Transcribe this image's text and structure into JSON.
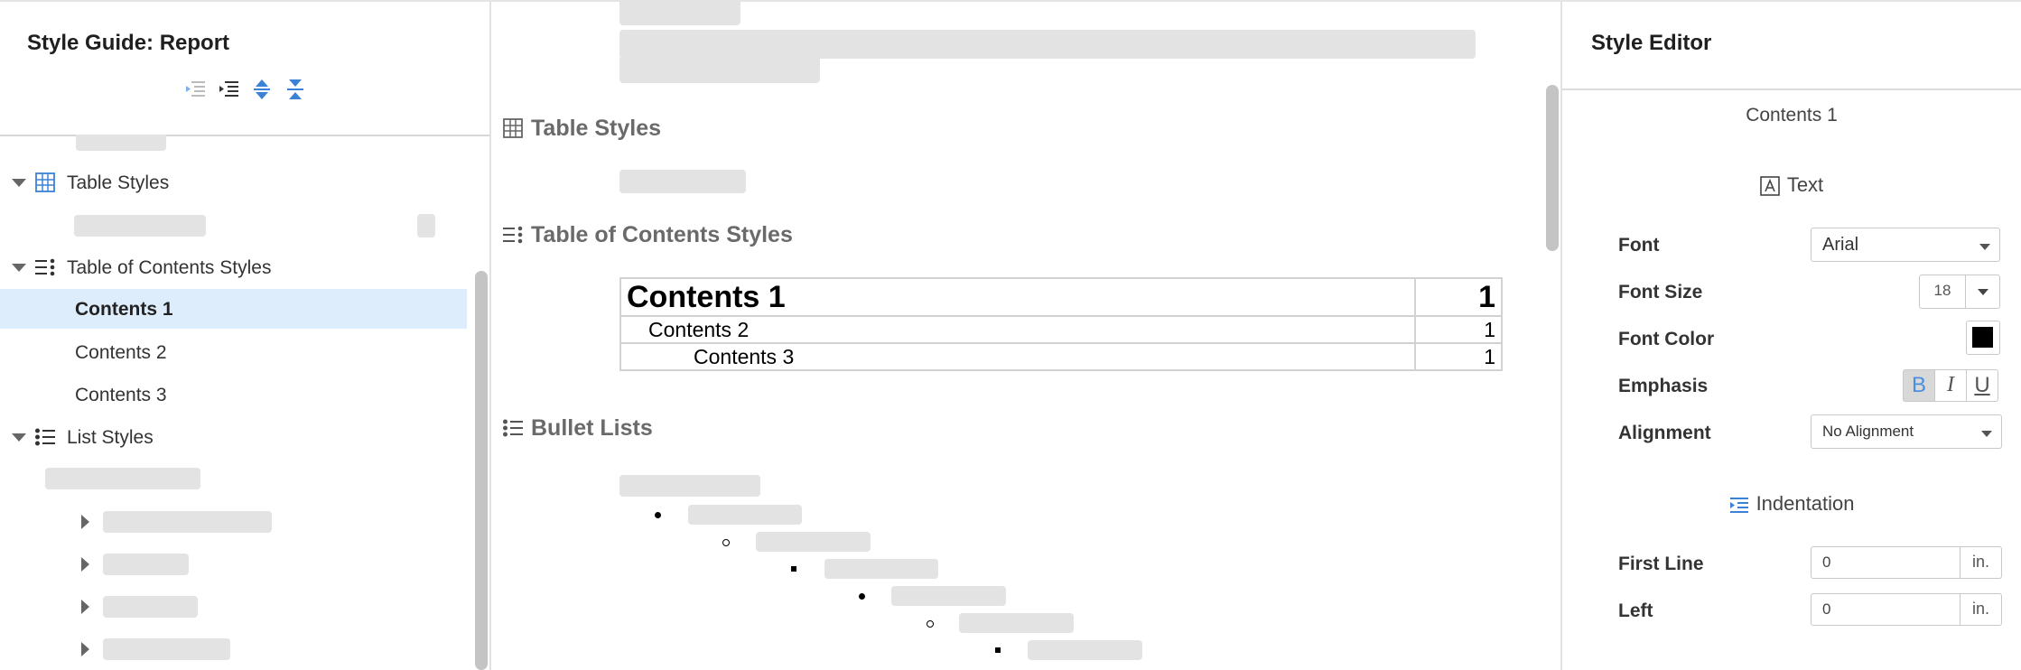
{
  "left": {
    "title": "Style Guide: Report",
    "toolbar": [
      "outdent-icon",
      "indent-icon",
      "expand-all-icon",
      "collapse-all-icon"
    ],
    "tree": {
      "table_styles": "Table Styles",
      "toc_styles": "Table of Contents Styles",
      "toc_items": [
        "Contents 1",
        "Contents 2",
        "Contents 3"
      ],
      "selected": "Contents 1",
      "list_styles": "List Styles"
    }
  },
  "center": {
    "sections": {
      "table_styles": "Table Styles",
      "toc_styles": "Table of Contents Styles",
      "bullet_lists": "Bullet Lists"
    },
    "toc_preview": [
      {
        "label": "Contents 1",
        "page": "1"
      },
      {
        "label": "Contents 2",
        "page": "1"
      },
      {
        "label": "Contents 3",
        "page": "1"
      }
    ]
  },
  "right": {
    "title": "Style Editor",
    "style_name": "Contents 1",
    "text_group": "Text",
    "font_label": "Font",
    "font_value": "Arial",
    "font_size_label": "Font Size",
    "font_size_value": "18",
    "font_color_label": "Font Color",
    "font_color_value": "#000000",
    "emphasis_label": "Emphasis",
    "emphasis": {
      "bold": "B",
      "italic": "I",
      "underline": "U",
      "bold_active": true
    },
    "alignment_label": "Alignment",
    "alignment_value": "No Alignment",
    "indent_group": "Indentation",
    "first_line_label": "First Line",
    "first_line_value": "0",
    "left_label": "Left",
    "left_value": "0",
    "unit": "in."
  },
  "colors": {
    "selection": "#deedfb",
    "accent": "#3b82d6",
    "placeholder": "#e3e3e3"
  }
}
